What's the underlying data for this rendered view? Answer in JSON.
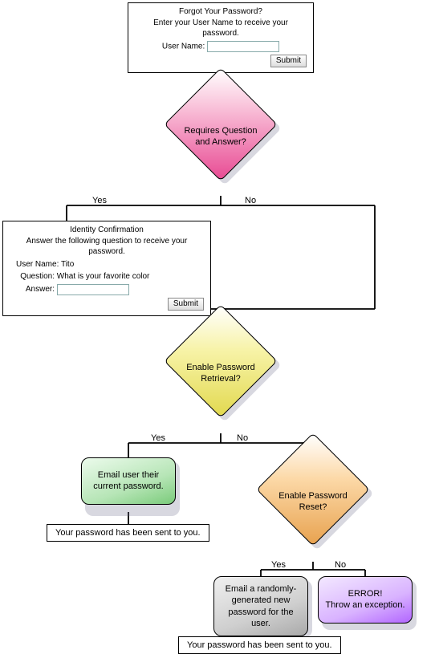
{
  "form1": {
    "title": "Forgot Your Password?",
    "subtitle": "Enter your User Name to receive your password.",
    "username_label": "User Name:",
    "username_value": "",
    "submit": "Submit"
  },
  "decision1": {
    "label": "Requires Question and Answer?",
    "yes": "Yes",
    "no": "No"
  },
  "form2": {
    "title": "Identity Confirmation",
    "subtitle": "Answer the following question to receive your password.",
    "username_label": "User Name:",
    "username_value": "Tito",
    "question_label": "Question:",
    "question_value": "What is your favorite color",
    "answer_label": "Answer:",
    "answer_value": "",
    "submit": "Submit"
  },
  "decision2": {
    "label": "Enable Password Retrieval?",
    "yes": "Yes",
    "no": "No"
  },
  "result_green": "Email user their current password.",
  "caption1": "Your password has been sent to you.",
  "decision3": {
    "label": "Enable Password Reset?",
    "yes": "Yes",
    "no": "No"
  },
  "result_grey": "Email a randomly-generated new password for the user.",
  "result_purple": "ERROR!\nThrow an exception.",
  "caption2": "Your password has been sent to you."
}
